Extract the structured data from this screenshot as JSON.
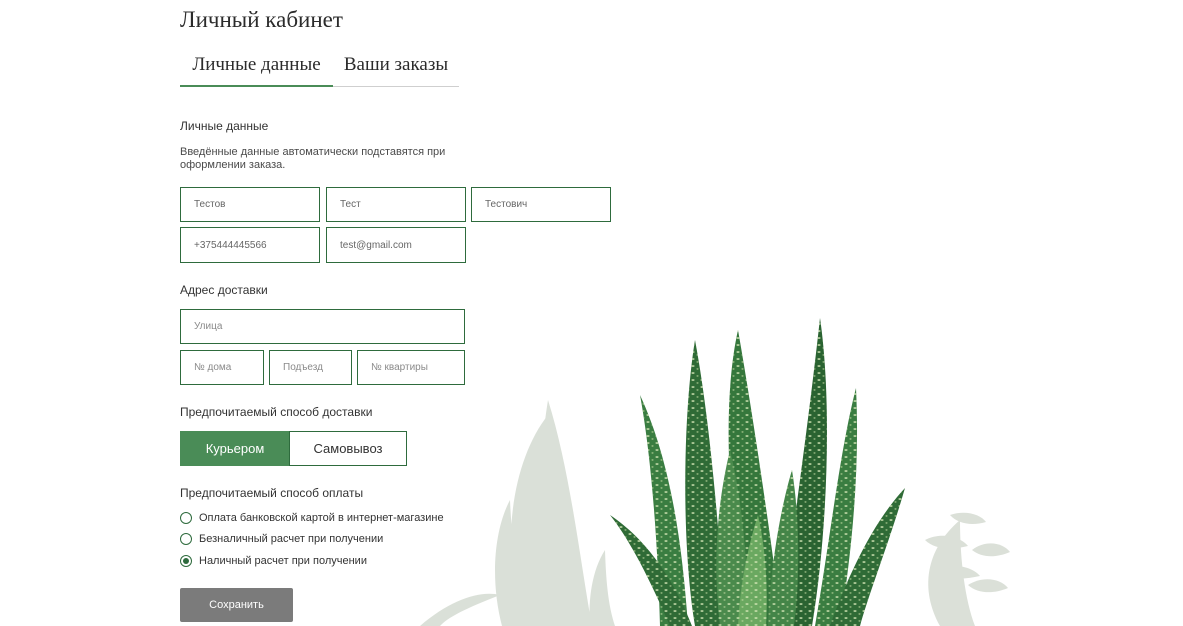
{
  "page": {
    "title": "Личный кабинет"
  },
  "tabs": [
    {
      "label": "Личные данные",
      "active": true
    },
    {
      "label": "Ваши заказы",
      "active": false
    }
  ],
  "personal": {
    "heading": "Личные данные",
    "note": "Введённые данные автоматически подставятся при оформлении заказа.",
    "fields": {
      "last_name": "Тестов",
      "first_name": "Тест",
      "middle_name": "Тестович",
      "phone": "+375444445566",
      "email": "test@gmail.com"
    }
  },
  "address": {
    "heading": "Адрес доставки",
    "street_placeholder": "Улица",
    "house_placeholder": "№ дома",
    "entrance_placeholder": "Подъезд",
    "apartment_placeholder": "№ квартиры"
  },
  "delivery": {
    "heading": "Предпочитаемый способ доставки",
    "options": [
      "Курьером",
      "Самовывоз"
    ],
    "selected": "Курьером"
  },
  "payment": {
    "heading": "Предпочитаемый способ оплаты",
    "options": [
      "Оплата банковской картой в интернет-магазине",
      "Безналичный расчет при получении",
      "Наличный расчет при получении"
    ],
    "selected_index": 2
  },
  "actions": {
    "save_label": "Сохранить"
  },
  "colors": {
    "accent": "#4a8c57",
    "border": "#2e6b3d",
    "save_button": "#7b7b7b"
  }
}
